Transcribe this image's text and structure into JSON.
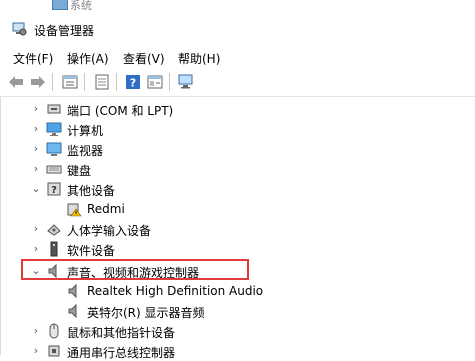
{
  "background_window": {
    "label": "系统"
  },
  "window": {
    "title": "设备管理器"
  },
  "menu": [
    "文件(F)",
    "操作(A)",
    "查看(V)",
    "帮助(H)"
  ],
  "toolbar": {
    "buttons": [
      "back-icon",
      "forward-icon",
      "properties-icon",
      "update-driver-icon",
      "help-icon",
      "show-hidden-icon",
      "scan-hardware-icon"
    ]
  },
  "tree": {
    "items": [
      {
        "label": "端口 (COM 和 LPT)",
        "icon": "port-icon",
        "expanded": false
      },
      {
        "label": "计算机",
        "icon": "computer-icon",
        "expanded": false
      },
      {
        "label": "监视器",
        "icon": "monitor-icon",
        "expanded": false
      },
      {
        "label": "键盘",
        "icon": "keyboard-icon",
        "expanded": false
      },
      {
        "label": "其他设备",
        "icon": "other-devices-icon",
        "expanded": true
      },
      {
        "label": "Redmi",
        "icon": "warning-device-icon",
        "child": true
      },
      {
        "label": "人体学输入设备",
        "icon": "hid-icon",
        "expanded": false
      },
      {
        "label": "软件设备",
        "icon": "software-device-icon",
        "expanded": false
      },
      {
        "label": "声音、视频和游戏控制器",
        "icon": "speaker-icon",
        "expanded": true,
        "selected_highlight": true
      },
      {
        "label": "Realtek High Definition Audio",
        "icon": "speaker-icon",
        "child": true
      },
      {
        "label": "英特尔(R) 显示器音频",
        "icon": "speaker-icon",
        "child": true
      },
      {
        "label": "鼠标和其他指针设备",
        "icon": "mouse-icon",
        "expanded": false
      },
      {
        "label": "通用串行总线控制器",
        "icon": "usb-icon",
        "expanded": false
      }
    ]
  },
  "colors": {
    "highlight_border": "#e03a3a"
  }
}
